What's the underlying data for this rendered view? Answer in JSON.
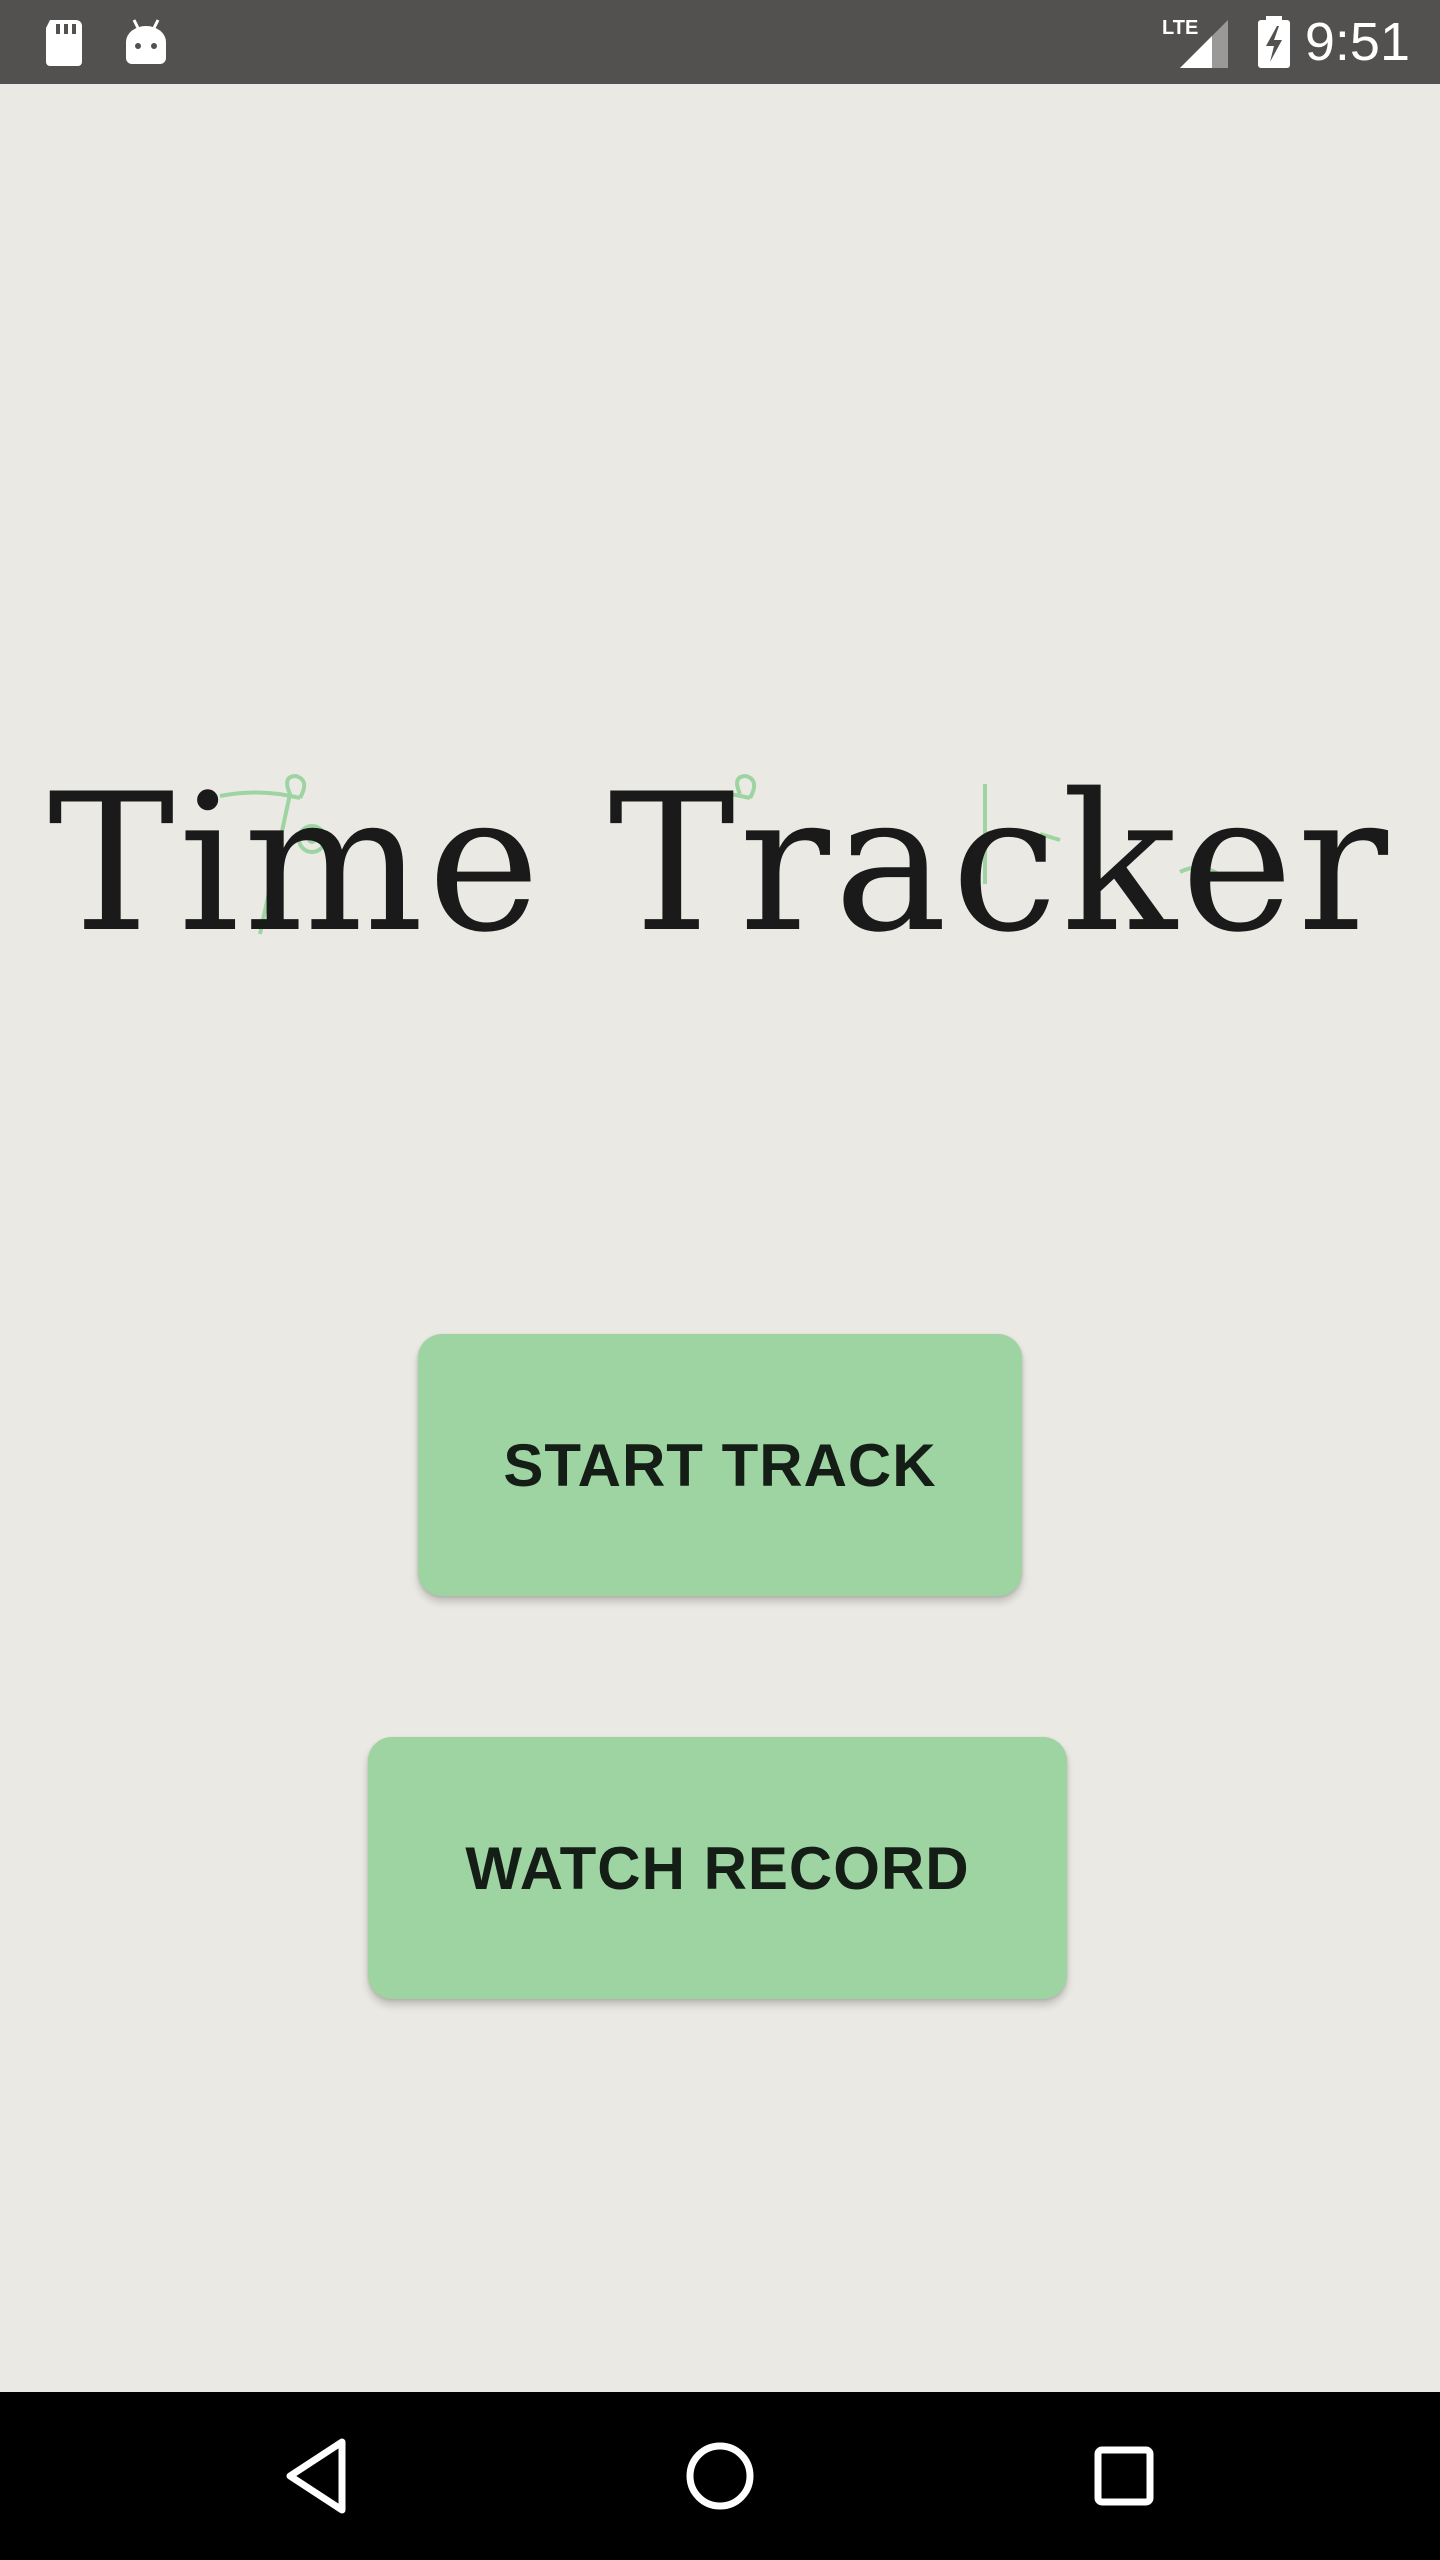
{
  "status_bar": {
    "time": "9:51",
    "network": "LTE",
    "icons": [
      "sd-card-icon",
      "android-icon",
      "lte-signal-icon",
      "battery-charging-icon"
    ]
  },
  "app": {
    "title": "Time Tracker",
    "accent_color": "#9dd4a2",
    "background_color": "#ebe9e3"
  },
  "buttons": {
    "start_track_label": "START TRACK",
    "watch_record_label": "WATCH RECORD"
  },
  "nav_bar": {
    "icons": [
      "back-icon",
      "home-icon",
      "recents-icon"
    ]
  }
}
